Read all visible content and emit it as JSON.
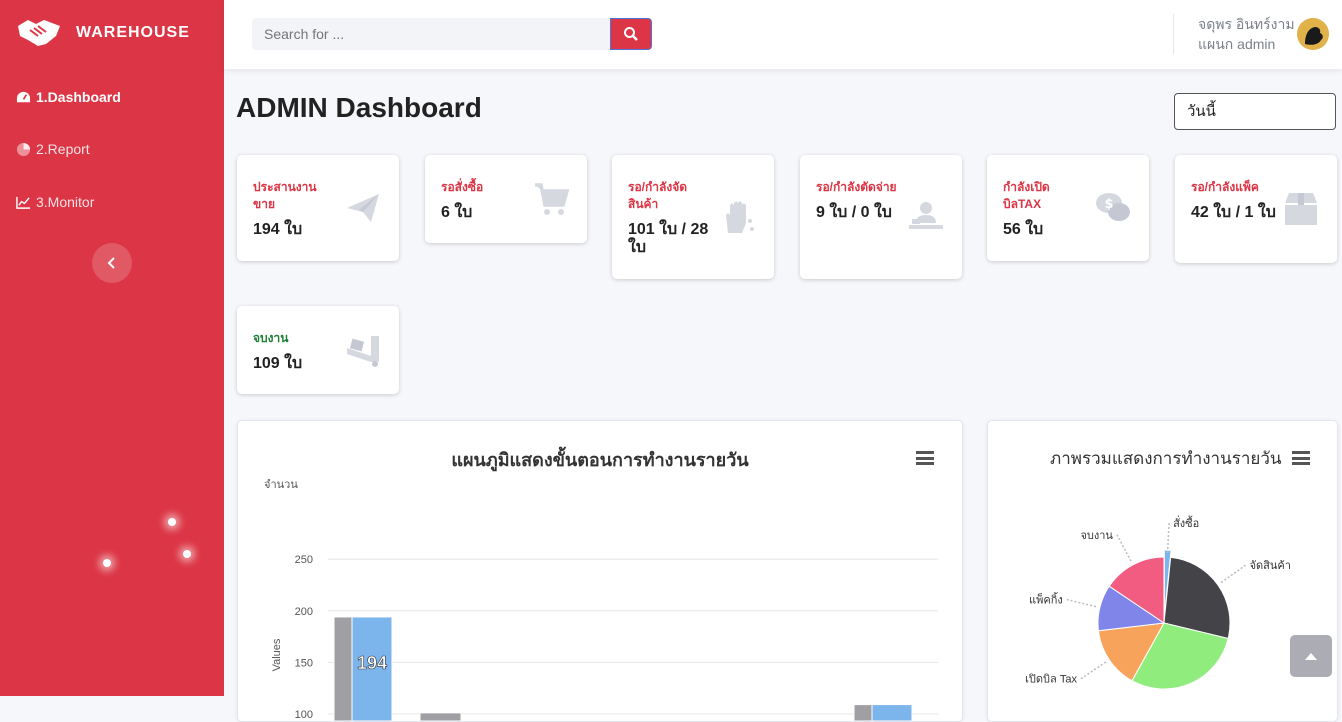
{
  "brand": {
    "name": "WAREHOUSE"
  },
  "sidebar": {
    "items": [
      {
        "label": "1.Dashboard",
        "icon": "tachometer-icon",
        "active": true
      },
      {
        "label": "2.Report",
        "icon": "pie-chart-icon",
        "active": false
      },
      {
        "label": "3.Monitor",
        "icon": "line-chart-icon",
        "active": false
      }
    ]
  },
  "search": {
    "placeholder": "Search for ..."
  },
  "user": {
    "name": "จดุพร อินทร์งาม",
    "department": "แผนก admin"
  },
  "page": {
    "title": "ADMIN Dashboard",
    "date_filter": "วันนี้"
  },
  "cards": [
    {
      "label": "ประสานงานขาย",
      "value": "194 ใบ",
      "icon": "paper-plane-icon"
    },
    {
      "label": "รอสั่งซื้อ",
      "value": "6 ใบ",
      "icon": "shopping-cart-icon"
    },
    {
      "label": "รอ/กำลังจัดสินค้า",
      "value": "101 ใบ / 28 ใบ",
      "icon": "hand-sparkles-icon"
    },
    {
      "label": "รอ/กำลังตัดจ่าย",
      "value": "9 ใบ / 0 ใบ",
      "icon": "person-desk-icon"
    },
    {
      "label": "กำลังเปิดบิลTAX",
      "value": "56 ใบ",
      "icon": "comments-dollar-icon"
    },
    {
      "label": "รอ/กำลังแพ็ค",
      "value": "42 ใบ / 1 ใบ",
      "icon": "box-icon"
    },
    {
      "label": "จบงาน",
      "value": "109 ใบ",
      "icon": "truck-loading-icon"
    }
  ],
  "bar_panel": {
    "title": "แผนภูมิแสดงขั้นตอนการทำงานรายวัน",
    "y_unit": "จำนวน",
    "y_axis_title": "Values"
  },
  "pie_panel": {
    "title": "ภาพรวมแสดงการทำงานรายวัน"
  },
  "chart_data": [
    {
      "type": "bar",
      "title": "แผนภูมิแสดงขั้นตอนการทำงานรายวัน",
      "ylabel": "Values",
      "y_unit_label": "จำนวน",
      "ylim": [
        0,
        250
      ],
      "yticks": [
        100,
        150,
        200,
        250
      ],
      "grid": true,
      "colors": {
        "gray": "#a0a0a4",
        "blue": "#7cb5ec"
      },
      "bars": [
        {
          "group": 1,
          "series": "gray",
          "value": 194
        },
        {
          "group": 1,
          "series": "blue",
          "value": 194,
          "data_label": "194"
        },
        {
          "group": 2,
          "series": "gray",
          "value": 101
        },
        {
          "group": 7,
          "series": "gray",
          "value": 109
        },
        {
          "group": 7,
          "series": "blue",
          "value": 109
        }
      ]
    },
    {
      "type": "pie",
      "title": "ภาพรวมแสดงการทำงานรายวัน",
      "labels": [
        "สั่งซื้อ",
        "จัดสินค้า",
        "เปิดบิล Tax",
        "แพ็คกิ้ง",
        "จบงาน"
      ],
      "slices": [
        {
          "label": "สั่งซื้อ",
          "value": 6,
          "color": "#7cb5ec"
        },
        {
          "label": "จัดสินค้า",
          "value": 101,
          "color": "#434348"
        },
        {
          "label": "",
          "value": 109,
          "color": "#90ed7d"
        },
        {
          "label": "เปิดบิล Tax",
          "value": 56,
          "color": "#f7a35c"
        },
        {
          "label": "แพ็คกิ้ง",
          "value": 42,
          "color": "#8085e9"
        },
        {
          "label": "จบงาน",
          "value": 58,
          "color": "#f15c80"
        }
      ]
    }
  ]
}
